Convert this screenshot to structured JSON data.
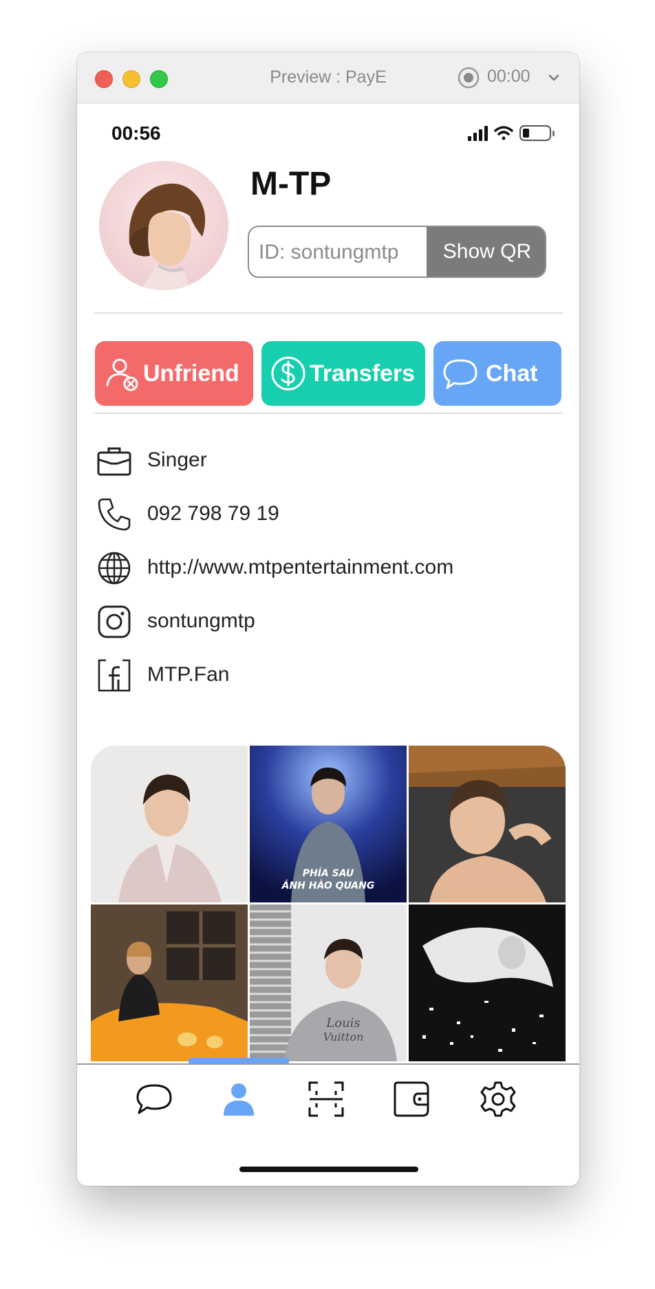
{
  "window": {
    "title": "Preview : PayE",
    "recording_time": "00:00"
  },
  "status_bar": {
    "time": "00:56"
  },
  "profile": {
    "name": "M-TP",
    "id_label": "ID: sontungmtp",
    "show_qr_label": "Show QR"
  },
  "actions": {
    "unfriend_label": "Unfriend",
    "transfers_label": "Transfers",
    "chat_label": "Chat"
  },
  "colors": {
    "unfriend": "#f46a6a",
    "transfers": "#17cfae",
    "chat": "#67a5f6",
    "tab_active": "#67a5f6"
  },
  "info": [
    {
      "icon": "briefcase-icon",
      "text": "Singer"
    },
    {
      "icon": "phone-icon",
      "text": "092 798 79 19"
    },
    {
      "icon": "globe-icon",
      "text": "http://www.mtpentertainment.com"
    },
    {
      "icon": "instagram-icon",
      "text": "sontungmtp"
    },
    {
      "icon": "facebook-icon",
      "text": "MTP.Fan"
    }
  ],
  "gallery": {
    "photo_2_caption_line1": "PHÍA SAU",
    "photo_2_caption_line2": "ÁNH HÀO QUANG",
    "photo_5_shirt_text_1": "Louis",
    "photo_5_shirt_text_2": "Vuitton"
  },
  "tabs": [
    {
      "icon": "chat-bubble-icon",
      "active": false
    },
    {
      "icon": "person-icon",
      "active": true
    },
    {
      "icon": "scan-icon",
      "active": false
    },
    {
      "icon": "wallet-icon",
      "active": false
    },
    {
      "icon": "settings-gear-icon",
      "active": false
    }
  ]
}
